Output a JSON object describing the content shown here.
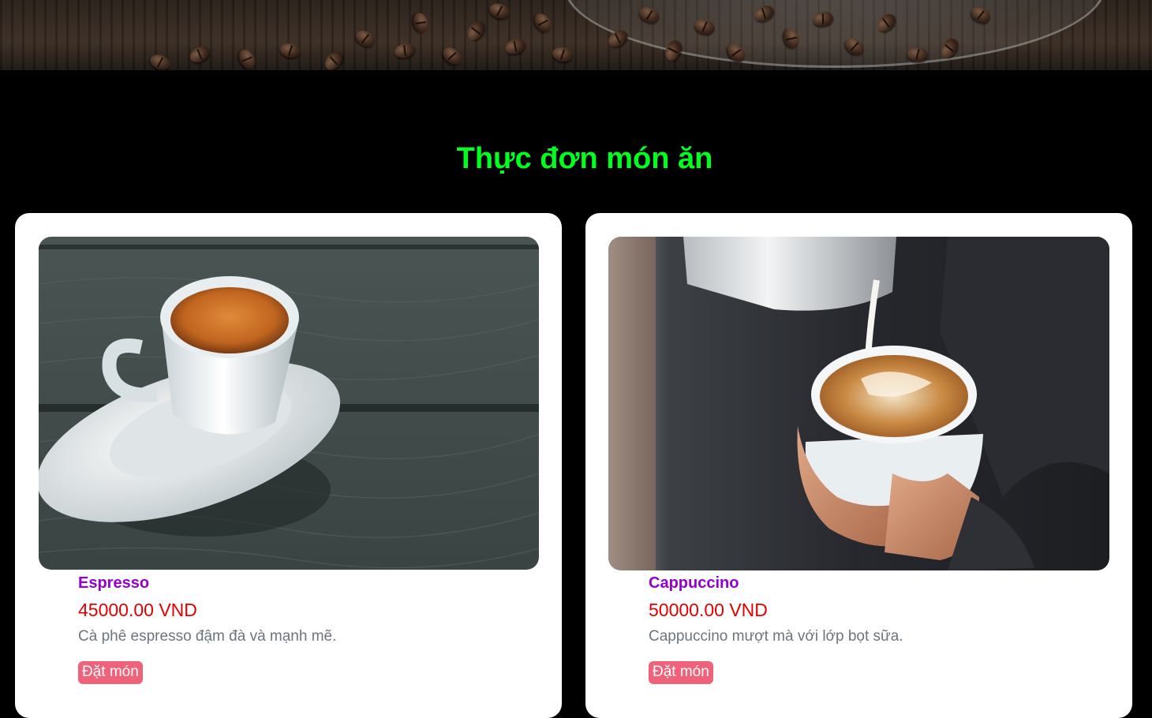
{
  "menu": {
    "title": "Thực đơn món ăn"
  },
  "items": [
    {
      "name": "Espresso",
      "price": "45000.00 VND",
      "description": "Cà phê espresso đậm đà và mạnh mẽ.",
      "button_label": "Đặt món"
    },
    {
      "name": "Cappuccino",
      "price": "50000.00 VND",
      "description": "Cappuccino mượt mà với lớp bọt sữa.",
      "button_label": "Đặt món"
    }
  ],
  "colors": {
    "background": "#000000",
    "title": "#00ff1f",
    "item_name": "#9400d3",
    "price": "#e50000",
    "description": "#6c757d",
    "button": "#f0627a"
  }
}
